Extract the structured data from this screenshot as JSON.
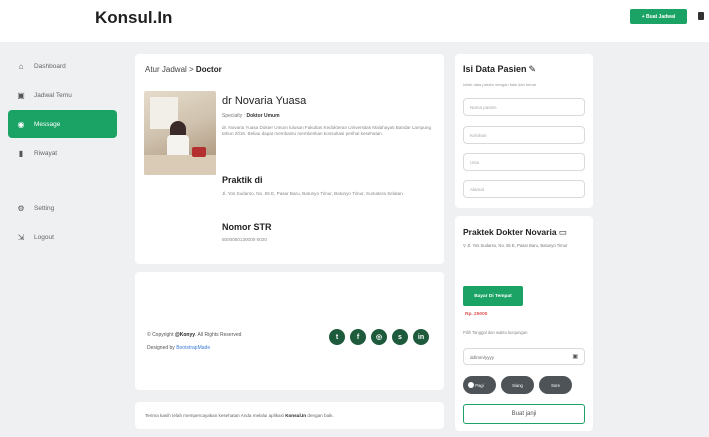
{
  "brand": "Konsul.In",
  "top_button": "+ Buat Jadwal",
  "sidebar": {
    "items": [
      {
        "label": "Dashboard",
        "icon": "home-icon"
      },
      {
        "label": "Jadwal Temu",
        "icon": "calendar-icon"
      },
      {
        "label": "Message",
        "icon": "message-icon",
        "active": true
      },
      {
        "label": "Riwayat",
        "icon": "bookmark-icon"
      },
      {
        "label": "Setting",
        "icon": "gear-icon"
      },
      {
        "label": "Logout",
        "icon": "logout-icon"
      }
    ]
  },
  "doctor": {
    "breadcrumb_prefix": "Atur Jadwal",
    "breadcrumb_sep": " > ",
    "breadcrumb_current": "Doctor",
    "name": "dr Novaria Yuasa",
    "specialty_label": "Specialty :",
    "specialty_value": "Doktor Umum",
    "description": "dr. Novaria Yuasa Dokter Umum lulusan Fakultas Kedokteran Universitas Malahayati Bandar Lampung tahun 2016. Beliau dapat membantu memberikan konsultasi perihal kesehatan.",
    "praktik_title": "Praktik di",
    "praktik_address": "Jl. Yos Sudarso, No. 55 E, Pasar Baru, Batunyo Timur, Batunyo Timur, Sumatera Selatan",
    "str_title": "Nomor STR",
    "str_value": "5000050130000-0020"
  },
  "footer": {
    "copyright_prefix": "© Copyright",
    "copyright_brand": "@Konyy",
    "copyright_suffix": ". All Rights Reserved",
    "designed_prefix": "Designed by",
    "designed_link": "BootstrapMade",
    "social": [
      "twitter-icon",
      "facebook-icon",
      "instagram-icon",
      "skype-icon",
      "linkedin-icon"
    ]
  },
  "note": {
    "text_before": "Terima kasih telah mempercayakan kesehatan Anda melalui aplikasi",
    "text_brand": "Konsul.In",
    "text_after": "dengan baik."
  },
  "patient_form": {
    "title": "Isi Data Pasien",
    "subtitle": "Isilah data pasien dengan baik dan benar",
    "fields": [
      "Nama pasien",
      "Keluhan",
      "Usia",
      "Alamat"
    ]
  },
  "praktek": {
    "title": "Praktek Dokter Novaria",
    "address": "Jl. Yos Sudarso, No. 55 E, Pasar Baru, Batunyo Timur",
    "pay_button": "Bayar Di Tempat",
    "price": "Rp. 25000",
    "pick_label": "Pilih Tanggal dan waktu kunjungan",
    "date_placeholder": "dd/mm/yyyy",
    "times": [
      "Pagi",
      "Siang",
      "Sore"
    ],
    "book_button": "Buat janji"
  }
}
